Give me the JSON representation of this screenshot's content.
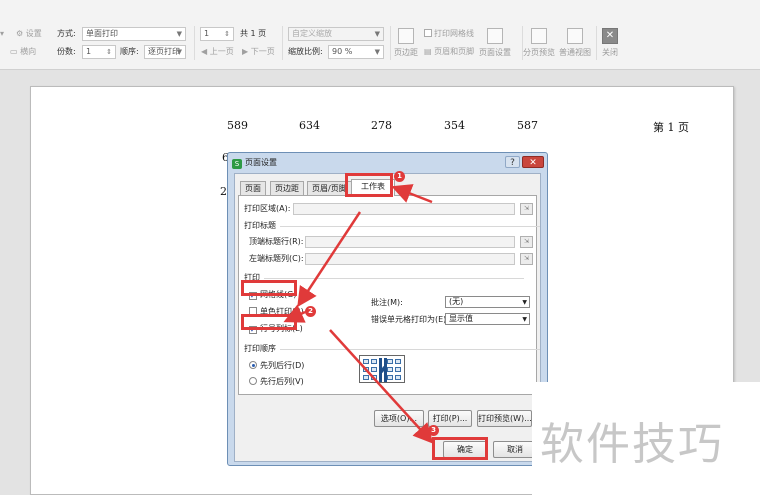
{
  "toolbar": {
    "settings_label": "设置",
    "landscape_label": "横向",
    "method_label": "方式:",
    "method_value": "单面打印",
    "copies_label": "份数:",
    "copies_value": "1",
    "order_label": "顺序:",
    "order_value": "逐页打印",
    "page_value": "1",
    "total_pages": "共 1 页",
    "prev_page": "上一页",
    "next_page": "下一页",
    "zoom_mode_value": "自定义缩放",
    "zoom_ratio_label": "缩放比例:",
    "zoom_ratio_value": "90 %",
    "margins_label": "页边距",
    "print_gridlines_label": "打印网格线",
    "header_footer_label": "页眉和页脚",
    "page_setup_label": "页面设置",
    "page_break_preview_label": "分页预览",
    "normal_view_label": "普通视图",
    "close_label": "关闭"
  },
  "sheet": {
    "row1": [
      "589",
      "634",
      "278",
      "354",
      "587"
    ],
    "row2_first": "6",
    "row3_first": "2",
    "page_number": "第 1 页"
  },
  "dialog": {
    "title": "页面设置",
    "help_label": "?",
    "close_label": "✕",
    "tabs": [
      "页面",
      "页边距",
      "页眉/页脚",
      "工作表"
    ],
    "print_area_label": "打印区域(A):",
    "print_titles_group": "打印标题",
    "top_title_rows_label": "顶端标题行(R):",
    "left_title_cols_label": "左端标题列(C):",
    "print_group": "打印",
    "gridlines_label": "网格线(G)",
    "gridlines_checked": true,
    "mono_label": "单色打印(B)",
    "mono_checked": false,
    "rowcol_label": "行号列标(L)",
    "rowcol_checked": true,
    "comments_label": "批注(M):",
    "comments_value": "(无)",
    "cell_errors_label": "错误单元格打印为(E):",
    "cell_errors_value": "显示值",
    "print_order_group": "打印顺序",
    "down_then_over_label": "先列后行(D)",
    "over_then_down_label": "先行后列(V)",
    "selected_order": "down_then_over",
    "options_button": "选项(O)...",
    "print_button": "打印(P)...",
    "preview_button": "打印预览(W)...",
    "ok_button": "确定",
    "cancel_button": "取消"
  },
  "annotations": {
    "badge1": "1",
    "badge2": "2",
    "badge3": "3",
    "color": "#e03a3a"
  },
  "watermark": "软件技巧"
}
